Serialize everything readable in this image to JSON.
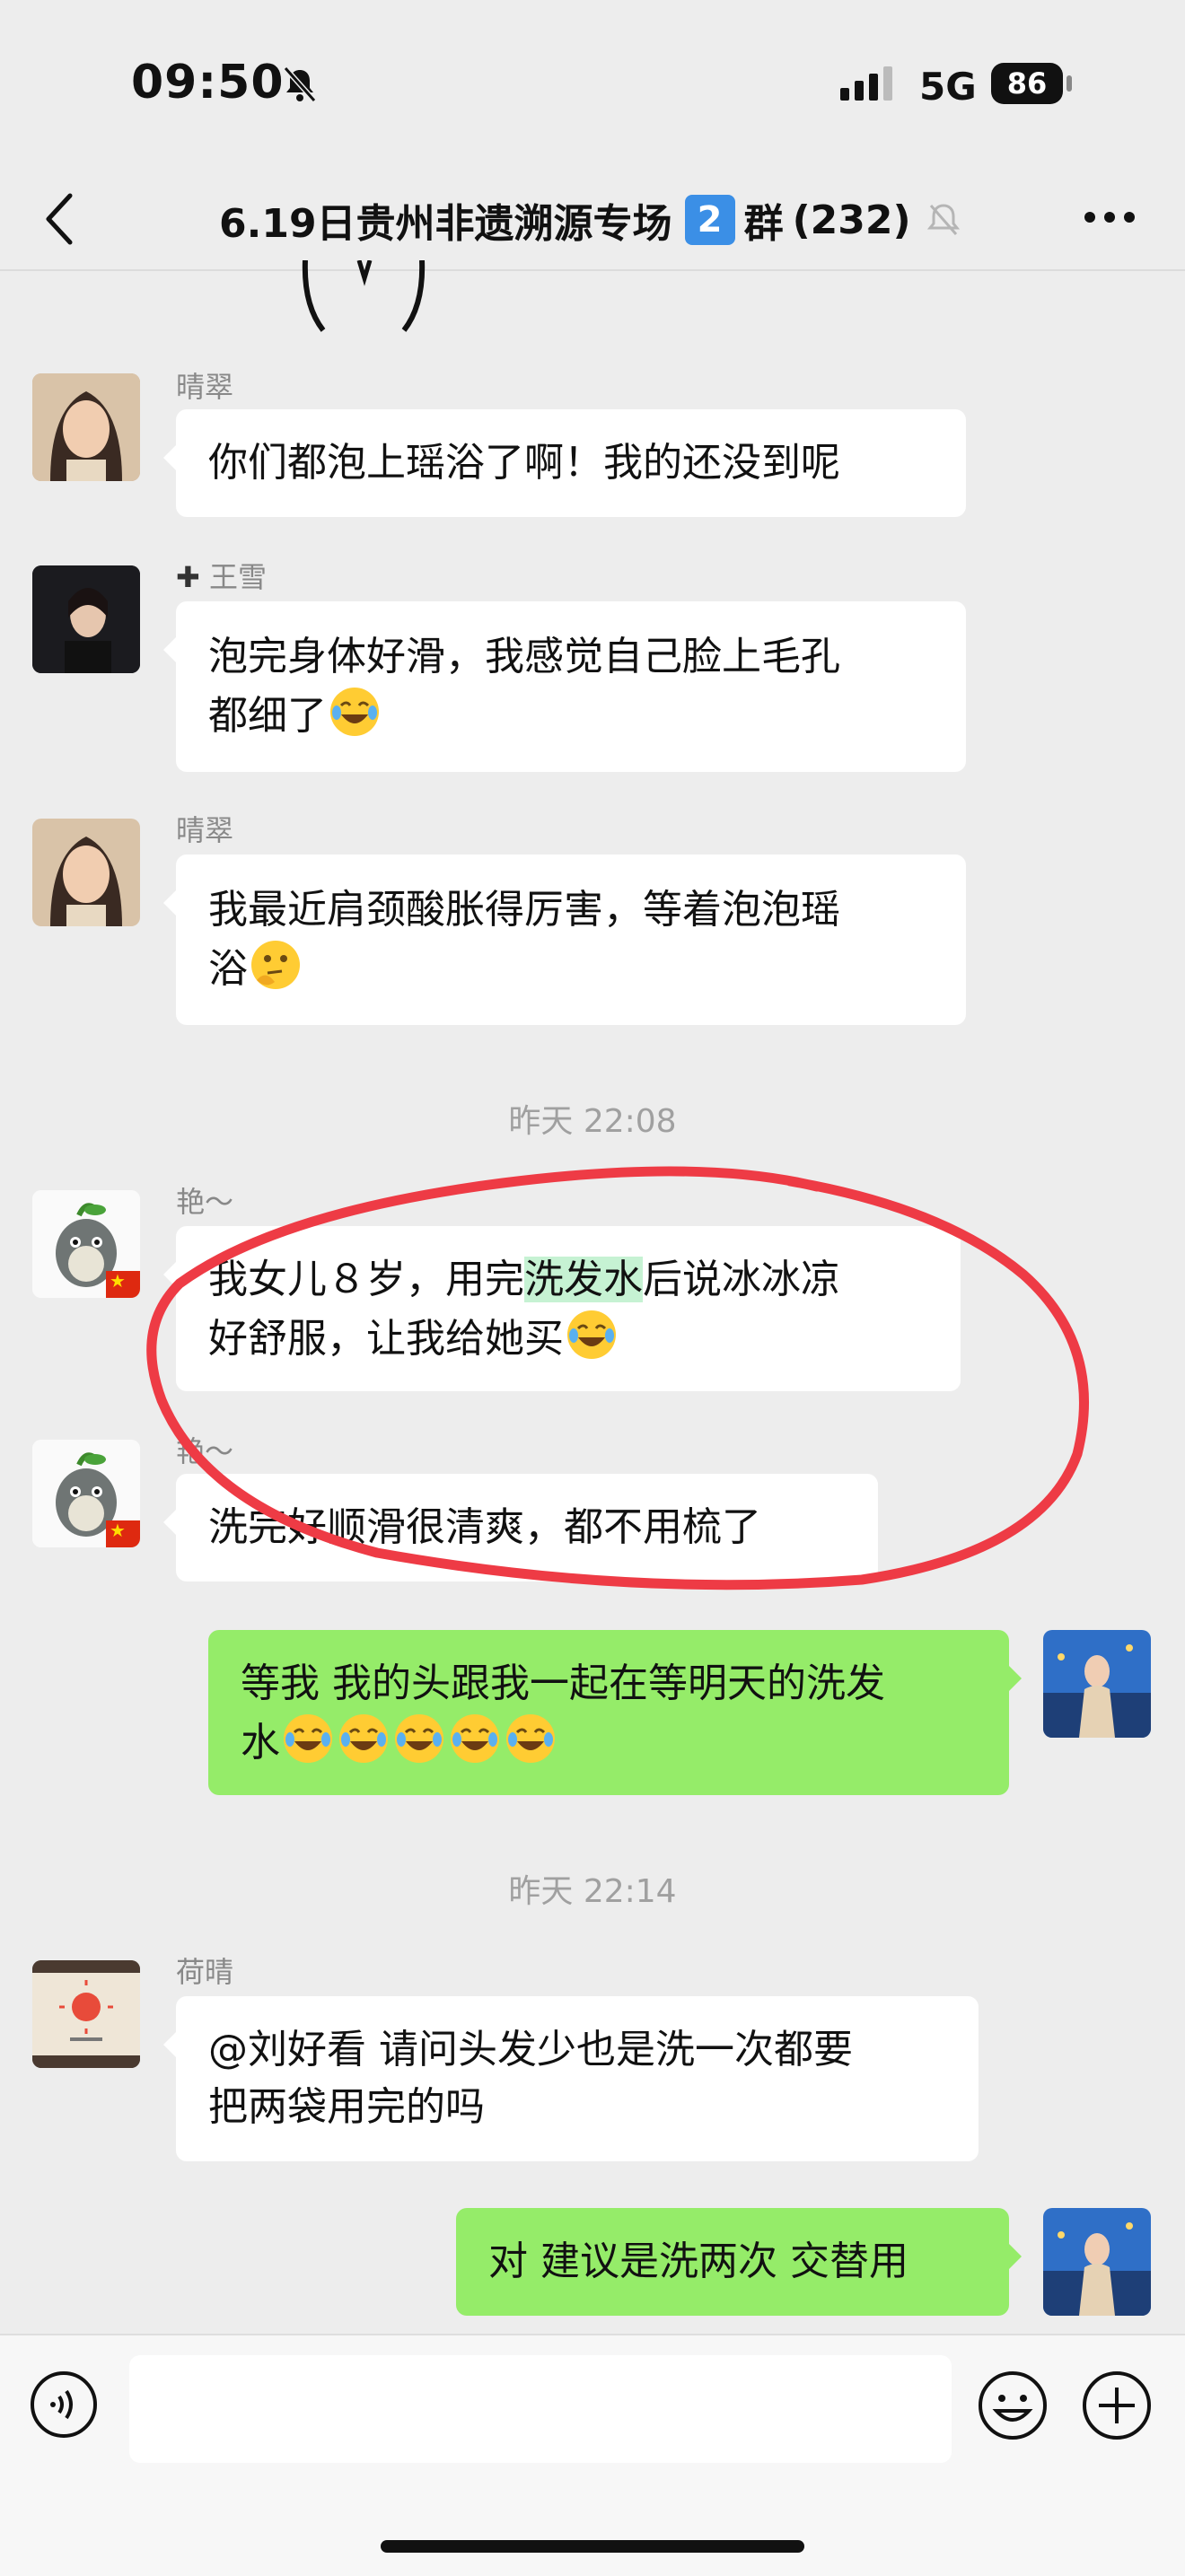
{
  "status_bar": {
    "time": "09:50",
    "network": "5G",
    "battery": "86"
  },
  "header": {
    "title": "6.19日贵州非遗溯源专场",
    "badge": "2",
    "suffix": "群",
    "count": "(232)"
  },
  "messages": [
    {
      "sender": "晴翠",
      "text": "你们都泡上瑶浴了啊！我的还没到呢"
    },
    {
      "sender": "王雪",
      "text_line1": "泡完身体好滑，我感觉自己脸上毛孔",
      "text_line2": "都细了"
    },
    {
      "sender": "晴翠",
      "text_line1": "我最近肩颈酸胀得厉害，等着泡泡瑶",
      "text_line2": "浴"
    },
    {
      "sender": "艳～",
      "text_pre": "我女儿８岁，用完",
      "text_hl": "洗发水",
      "text_post": "后说冰冰凉",
      "text_line2": "好舒服，让我给她买"
    },
    {
      "sender": "艳～",
      "text": "洗完好顺滑很清爽，都不用梳了"
    },
    {
      "text_line1": "等我 我的头跟我一起在等明天的洗发",
      "text_line2": "水"
    },
    {
      "sender": "荷晴",
      "text_line1": "@刘好看 请问头发少也是洗一次都要",
      "text_line2": "把两袋用完的吗"
    },
    {
      "text": "对 建议是洗两次 交替用"
    }
  ],
  "timestamps": [
    "昨天 22:08",
    "昨天 22:14"
  ],
  "icons": {
    "back": "back-chevron-icon",
    "more": "more-dots-icon",
    "mute": "bell-muted-icon",
    "voice": "voice-icon",
    "emoji": "emoji-icon",
    "plus": "plus-icon"
  },
  "colors": {
    "self_bubble": "#95ec69",
    "highlight": "#c6f2d3",
    "annotation": "#ee3b45"
  }
}
